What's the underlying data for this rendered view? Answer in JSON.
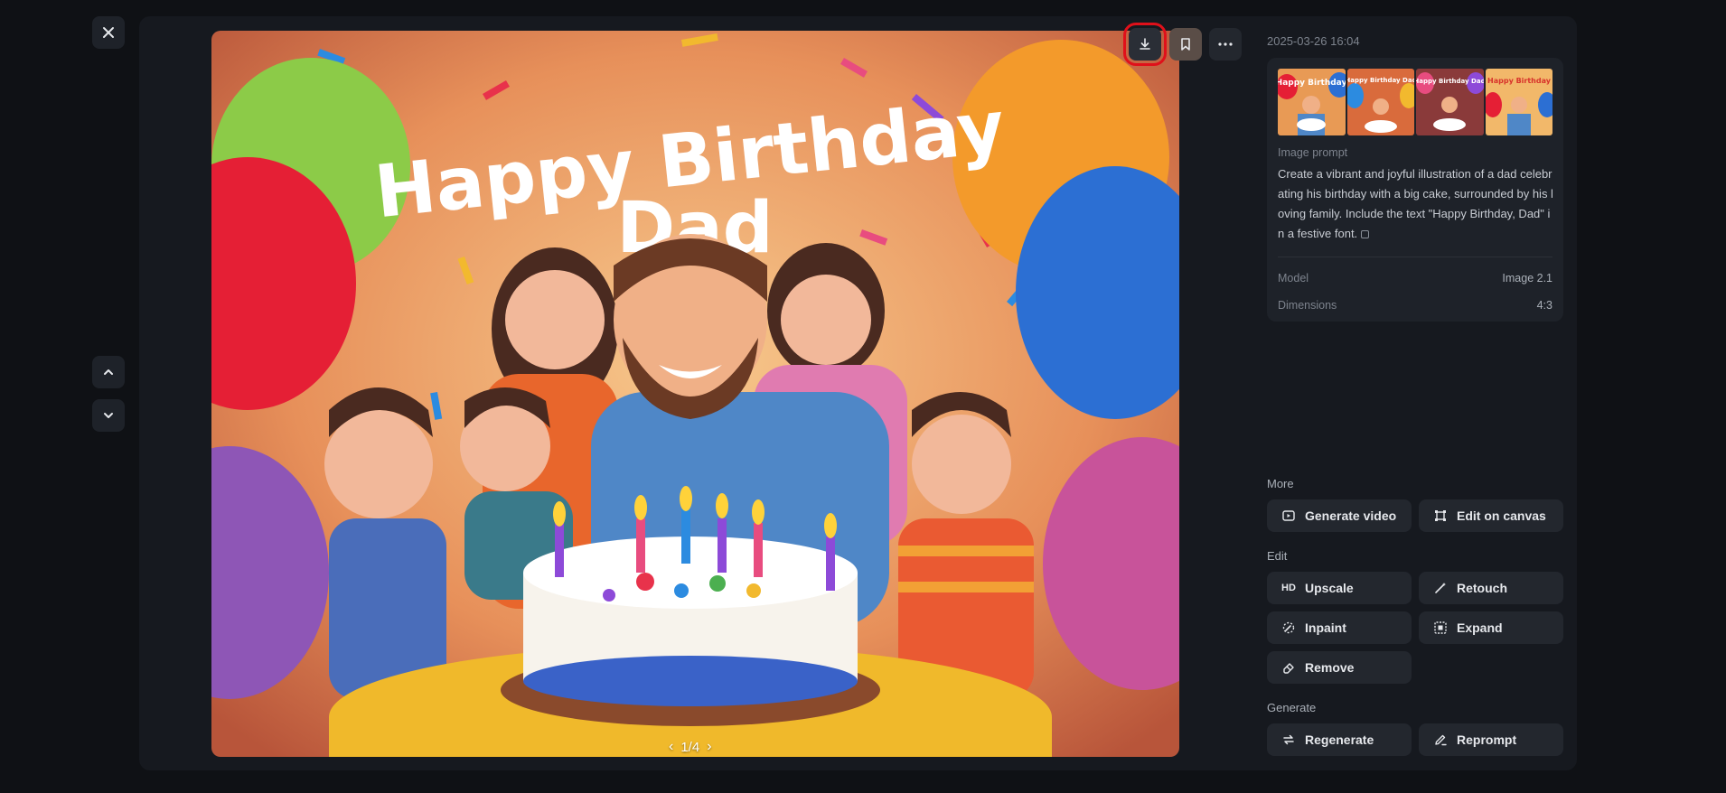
{
  "toolbar": {
    "download_icon": "download-icon",
    "bookmark_icon": "bookmark-icon",
    "more_icon": "more-icon"
  },
  "viewer": {
    "image_title_line1": "Happy Birthday",
    "image_title_line2": "Dad",
    "pager_text": "1/4"
  },
  "details": {
    "timestamp": "2025-03-26 16:04",
    "prompt_label": "Image prompt",
    "prompt_text": "Create a vibrant and joyful illustration of a dad celebrating his birthday with a big cake, surrounded by his loving family. Include the text \"Happy Birthday, Dad\" in a festive font.",
    "model_label": "Model",
    "model_value": "Image 2.1",
    "dimensions_label": "Dimensions",
    "dimensions_value": "4:3",
    "thumb_caption_1": "Happy Birthday",
    "thumb_caption_2": "Happy Birthday Dad",
    "thumb_caption_3": "Happy Birthday Dad",
    "thumb_caption_4": "Happy Birthday"
  },
  "sections": {
    "more": "More",
    "edit": "Edit",
    "generate": "Generate"
  },
  "actions": {
    "generate_video": "Generate video",
    "edit_on_canvas": "Edit on canvas",
    "upscale": "Upscale",
    "upscale_icon_text": "HD",
    "retouch": "Retouch",
    "inpaint": "Inpaint",
    "expand": "Expand",
    "remove": "Remove",
    "regenerate": "Regenerate",
    "reprompt": "Reprompt"
  },
  "colors": {
    "background": "#0f1115",
    "panel": "#16191f",
    "button": "#23272e",
    "highlight": "#e0101a"
  }
}
